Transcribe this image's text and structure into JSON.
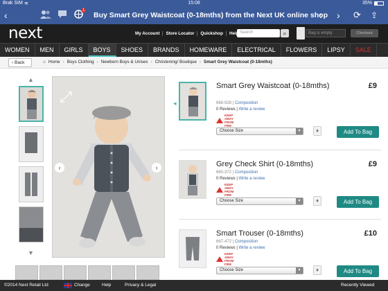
{
  "status_bar": {
    "carrier": "Brak SIM",
    "time": "15:08",
    "battery": "35%"
  },
  "browser": {
    "title": "Buy Smart Grey Waistcoat (0-18mths) from the Next UK online shop",
    "notification_count": "1"
  },
  "header": {
    "logo": "next",
    "links": [
      "My Account",
      "Store Locator",
      "Quickshop",
      "Help"
    ],
    "search_placeholder": "Search",
    "bag_text": "Bag is empty",
    "checkout_label": "Checkout"
  },
  "nav": [
    "WOMEN",
    "MEN",
    "GIRLS",
    "BOYS",
    "SHOES",
    "BRANDS",
    "HOMEWARE",
    "ELECTRICAL",
    "FLOWERS",
    "LIPSY",
    "SALE"
  ],
  "nav_active": "BOYS",
  "breadcrumb": {
    "back_label": "Back",
    "items": [
      "Home",
      "Boys Clothing",
      "Newborn Boys & Unisex",
      "Christening/ Boutique",
      "Smart Grey Waistcoat (0-18mths)"
    ]
  },
  "products": [
    {
      "name": "Smart Grey Waistcoat (0-18mths)",
      "price": "£9",
      "code": "668-928",
      "composition": "Composition",
      "reviews": "0 Reviews",
      "write_review": "Write a review",
      "warning": "KEEP AWAY FROM FIRE",
      "size_label": "Choose Size",
      "button": "Add To Bag"
    },
    {
      "name": "Grey Check Shirt (0-18mths)",
      "price": "£9",
      "code": "660-372",
      "composition": "Composition",
      "reviews": "0 Reviews",
      "write_review": "Write a review",
      "warning": "KEEP AWAY FROM FIRE",
      "size_label": "Choose Size",
      "button": "Add To Bag"
    },
    {
      "name": "Smart Trouser (0-18mths)",
      "price": "£10",
      "code": "667-472",
      "composition": "Composition",
      "reviews": "0 Reviews",
      "write_review": "Write a review",
      "warning": "KEEP AWAY FROM FIRE",
      "size_label": "Choose Size",
      "button": "Add To Bag"
    }
  ],
  "footer": {
    "copyright": "©2014 Next Retail Ltd",
    "change": "Change",
    "help": "Help",
    "privacy": "Privacy & Legal",
    "recently_viewed": "Recently Viewed"
  },
  "colors": {
    "browser_bar": "#3b5a9a",
    "header": "#1e1e1e",
    "accent": "#48b4a8",
    "button": "#1f8a84"
  }
}
